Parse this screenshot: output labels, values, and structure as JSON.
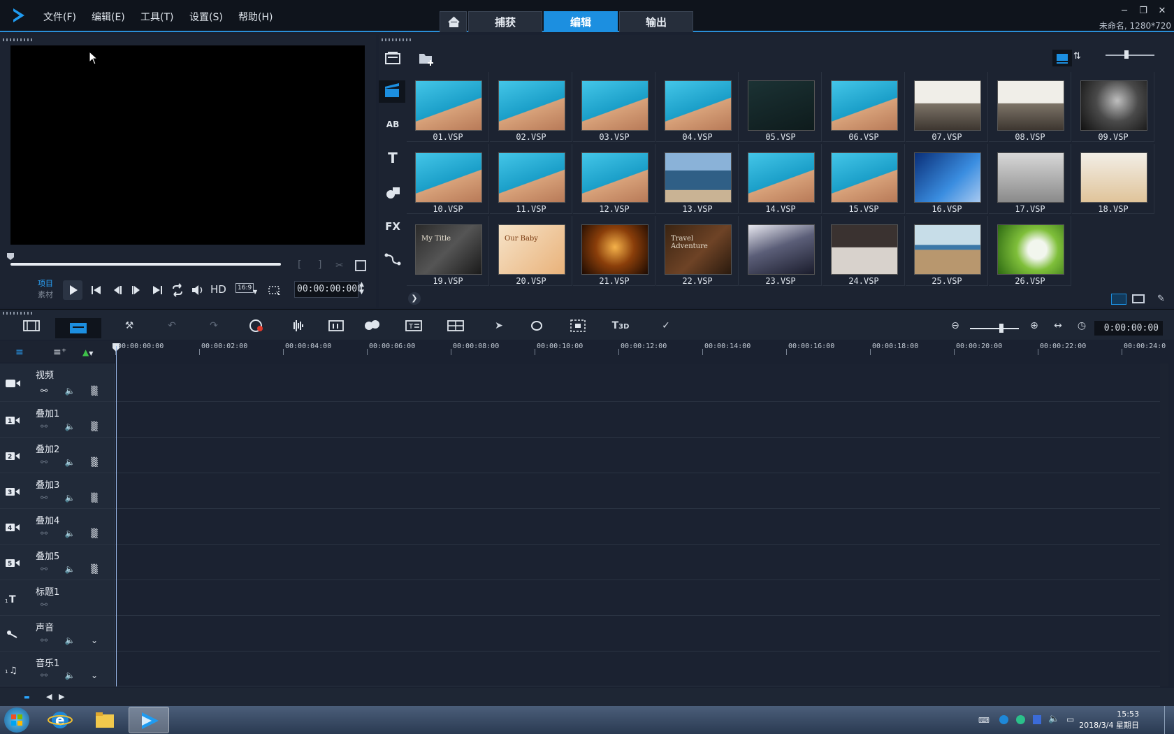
{
  "menu": [
    "文件(F)",
    "编辑(E)",
    "工具(T)",
    "设置(S)",
    "帮助(H)"
  ],
  "tabs": {
    "capture": "捕获",
    "edit": "编辑",
    "output": "输出"
  },
  "project_info": "未命名, 1280*720",
  "player": {
    "project_label": "项目",
    "clip_label": "素材",
    "hd_label": "HD",
    "aspect_label": "16:9",
    "timecode": "00:00:00:000"
  },
  "library": {
    "thumbnails": [
      {
        "label": "01.VSP",
        "kind": "boy"
      },
      {
        "label": "02.VSP",
        "kind": "boy"
      },
      {
        "label": "03.VSP",
        "kind": "boy"
      },
      {
        "label": "04.VSP",
        "kind": "boy"
      },
      {
        "label": "05.VSP",
        "kind": "dark"
      },
      {
        "label": "06.VSP",
        "kind": "boy"
      },
      {
        "label": "07.VSP",
        "kind": "street"
      },
      {
        "label": "08.VSP",
        "kind": "street"
      },
      {
        "label": "09.VSP",
        "kind": "bw"
      },
      {
        "label": "10.VSP",
        "kind": "boy"
      },
      {
        "label": "11.VSP",
        "kind": "boy"
      },
      {
        "label": "12.VSP",
        "kind": "boy"
      },
      {
        "label": "13.VSP",
        "kind": "sea"
      },
      {
        "label": "14.VSP",
        "kind": "boy"
      },
      {
        "label": "15.VSP",
        "kind": "boy"
      },
      {
        "label": "16.VSP",
        "kind": "blue"
      },
      {
        "label": "17.VSP",
        "kind": "tv"
      },
      {
        "label": "18.VSP",
        "kind": "bear"
      },
      {
        "label": "19.VSP",
        "kind": "title"
      },
      {
        "label": "20.VSP",
        "kind": "baby"
      },
      {
        "label": "21.VSP",
        "kind": "fire"
      },
      {
        "label": "22.VSP",
        "kind": "travel"
      },
      {
        "label": "23.VSP",
        "kind": "night"
      },
      {
        "label": "24.VSP",
        "kind": "crab"
      },
      {
        "label": "25.VSP",
        "kind": "beach"
      },
      {
        "label": "26.VSP",
        "kind": "leaf"
      }
    ],
    "thumb_text": {
      "title": "My Title",
      "baby": "Our Baby",
      "travel": "Travel Adventure"
    }
  },
  "timeline": {
    "timecode": "0:00:00:00",
    "ruler": [
      "00:00:00:00",
      "00:00:02:00",
      "00:00:04:00",
      "00:00:06:00",
      "00:00:08:00",
      "00:00:10:00",
      "00:00:12:00",
      "00:00:14:00",
      "00:00:16:00",
      "00:00:18:00",
      "00:00:20:00",
      "00:00:22:00",
      "00:00:24:0"
    ],
    "tracks": [
      {
        "name": "视频",
        "type": "video",
        "num": ""
      },
      {
        "name": "叠加1",
        "type": "overlay",
        "num": "1"
      },
      {
        "name": "叠加2",
        "type": "overlay",
        "num": "2"
      },
      {
        "name": "叠加3",
        "type": "overlay",
        "num": "3"
      },
      {
        "name": "叠加4",
        "type": "overlay",
        "num": "4"
      },
      {
        "name": "叠加5",
        "type": "overlay",
        "num": "5"
      },
      {
        "name": "标题1",
        "type": "title",
        "num": "1"
      },
      {
        "name": "声音",
        "type": "voice",
        "num": ""
      },
      {
        "name": "音乐1",
        "type": "music",
        "num": "1"
      }
    ]
  },
  "taskbar": {
    "time": "15:53",
    "date": "2018/3/4 星期日"
  },
  "colors": {
    "accent": "#1c8fe0",
    "bg": "#1a2130"
  }
}
